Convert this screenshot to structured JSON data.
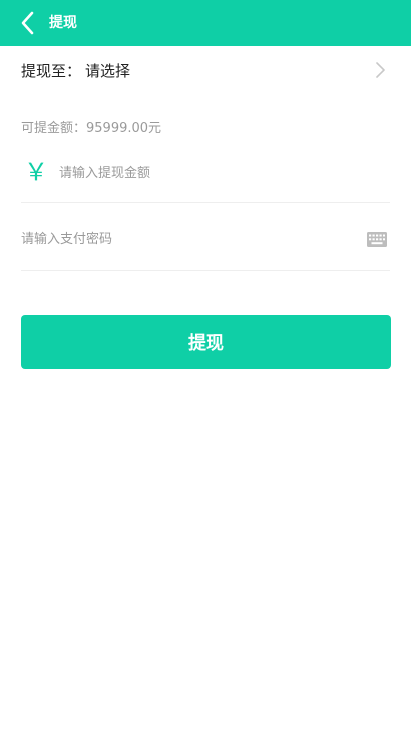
{
  "header": {
    "title": "提现",
    "back_icon": "chevron-left-icon"
  },
  "target": {
    "label": "提现至：",
    "value": "请选择",
    "chevron_icon": "chevron-right-icon"
  },
  "balance": {
    "text": "可提金额：95999.00元"
  },
  "amount": {
    "currency_symbol": "￥",
    "placeholder": "请输入提现金额"
  },
  "password": {
    "placeholder": "请输入支付密码",
    "keyboard_icon": "keyboard-icon"
  },
  "submit": {
    "label": "提现"
  },
  "colors": {
    "accent": "#0fcfa6",
    "muted_text": "#9a9a9a",
    "divider": "#eeeeee"
  }
}
